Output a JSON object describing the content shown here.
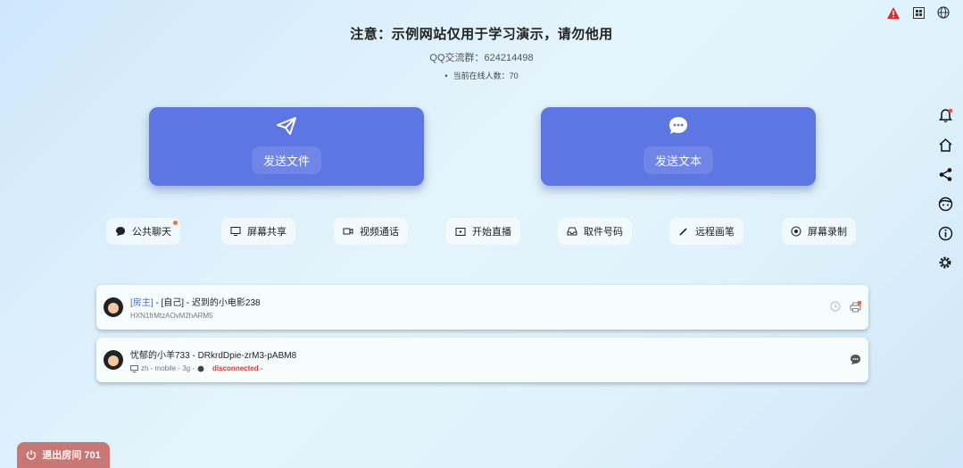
{
  "header": {
    "notice": "注意：示例网站仅用于学习演示，请勿他用",
    "qq_group": "QQ交流群：624214498",
    "online_count": "当前在线人数：70"
  },
  "top_icons": [
    "warning-icon",
    "grid-icon",
    "globe-icon"
  ],
  "main_buttons": {
    "send_file": "发送文件",
    "send_text": "发送文本"
  },
  "actions": {
    "public_chat": "公共聊天",
    "screen_share": "屏幕共享",
    "video_call": "视频通话",
    "start_live": "开始直播",
    "pickup_code": "取件号码",
    "remote_pen": "远程画笔",
    "screen_record": "屏幕录制"
  },
  "sidebar_icons": [
    "bell-icon",
    "home-icon",
    "share-icon",
    "face-icon",
    "info-icon",
    "gear-icon"
  ],
  "users": [
    {
      "tag": "[房主]",
      "sep": " - ",
      "self": "[自己]",
      "name": " - 迟到的小电影238",
      "id": "HXN1frMtzAOvM2hARM5"
    },
    {
      "name": "忧郁的小羊733 - DRkrdDpie-zrM3-pABM8",
      "meta": "zh - mobile - 3g -",
      "status": "disconnected -"
    }
  ],
  "exit_button": "退出房间 701"
}
